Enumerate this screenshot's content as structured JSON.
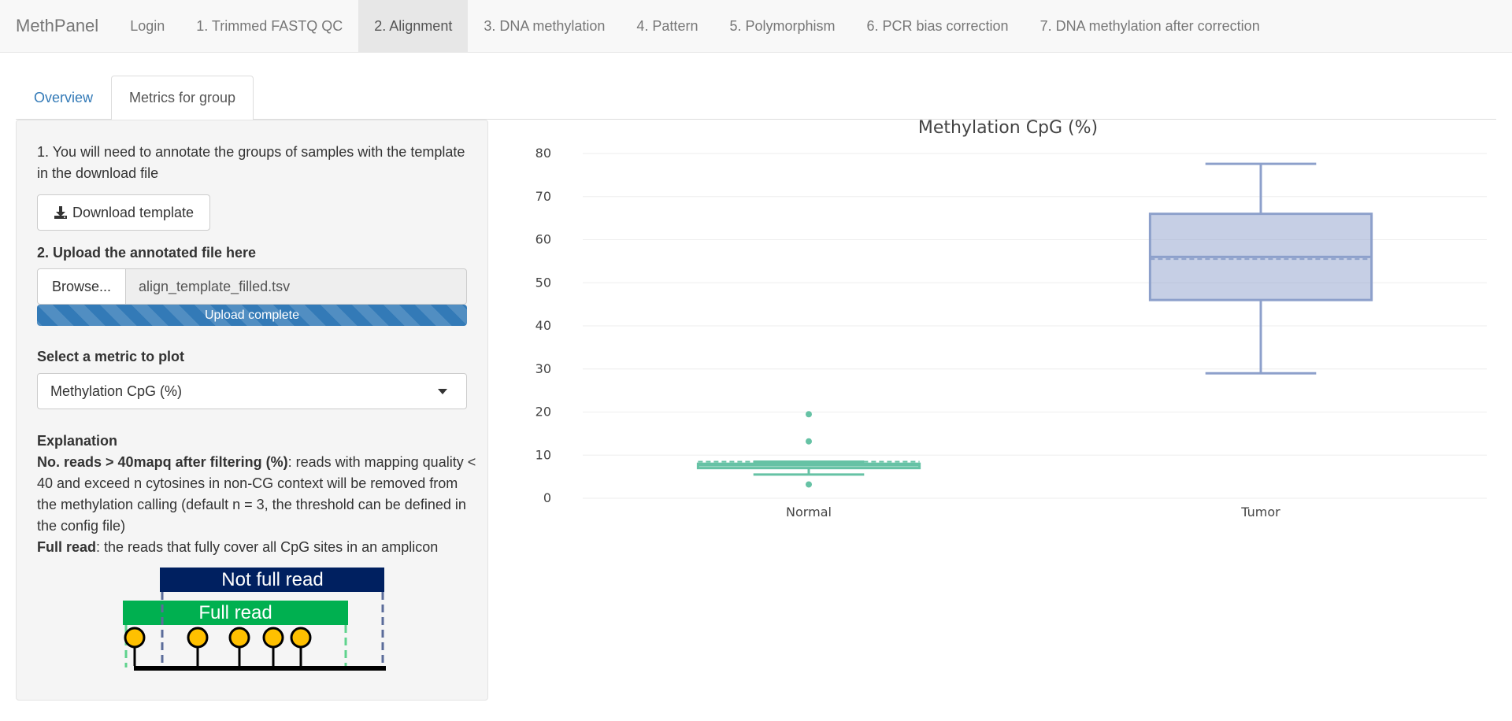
{
  "navbar": {
    "brand": "MethPanel",
    "items": [
      {
        "label": "Login",
        "active": false
      },
      {
        "label": "1. Trimmed FASTQ QC",
        "active": false
      },
      {
        "label": "2. Alignment",
        "active": true
      },
      {
        "label": "3. DNA methylation",
        "active": false
      },
      {
        "label": "4. Pattern",
        "active": false
      },
      {
        "label": "5. Polymorphism",
        "active": false
      },
      {
        "label": "6. PCR bias correction",
        "active": false
      },
      {
        "label": "7. DNA methylation after correction",
        "active": false
      }
    ]
  },
  "tabs": [
    {
      "label": "Overview",
      "active": false
    },
    {
      "label": "Metrics for group",
      "active": true
    }
  ],
  "sidebar": {
    "step1_text": "1. You will need to annotate the groups of samples with the template in the download file",
    "download_button": "Download template",
    "download_icon": "download-icon",
    "step2_label": "2. Upload the annotated file here",
    "browse_button": "Browse...",
    "file_name": "align_template_filled.tsv",
    "upload_status": "Upload complete",
    "upload_progress": 1.0,
    "metric_label": "Select a metric to plot",
    "metric_selected": "Methylation CpG (%)",
    "explanation_title": "Explanation",
    "explanation_term1": "No. reads > 40mapq after filtering (%)",
    "explanation_text1": ": reads with mapping quality < 40 and exceed n cytosines in non-CG context will be removed from the methylation calling (default n = 3, the threshold can be defined in the config file)",
    "explanation_term2": "Full read",
    "explanation_text2": ": the reads that fully cover all CpG sites in an amplicon",
    "diagram": {
      "not_full_label": "Not full read",
      "full_label": "Full read",
      "colors": {
        "not_full": "#002060",
        "full": "#00b050",
        "cpg": "#ffc000"
      }
    }
  },
  "chart_data": {
    "type": "box",
    "title": "Methylation CpG (%)",
    "xlabel": "",
    "ylabel": "",
    "ylim": [
      0,
      80
    ],
    "yticks": [
      0,
      10,
      20,
      30,
      40,
      50,
      60,
      70,
      80
    ],
    "grid": true,
    "categories": [
      "Normal",
      "Tumor"
    ],
    "boxes": [
      {
        "category": "Normal",
        "color": "#66c2a5",
        "lowerfence": 5.5,
        "q1": 7,
        "median": 7.7,
        "mean": 8.5,
        "q3": 8,
        "upperfence": 8.5,
        "outliers": [
          19.5,
          13.2,
          3.2
        ]
      },
      {
        "category": "Tumor",
        "color": "#8da0cb",
        "lowerfence": 29,
        "q1": 46,
        "median": 56,
        "mean": 55.5,
        "q3": 66,
        "upperfence": 77.6,
        "outliers": []
      }
    ]
  }
}
